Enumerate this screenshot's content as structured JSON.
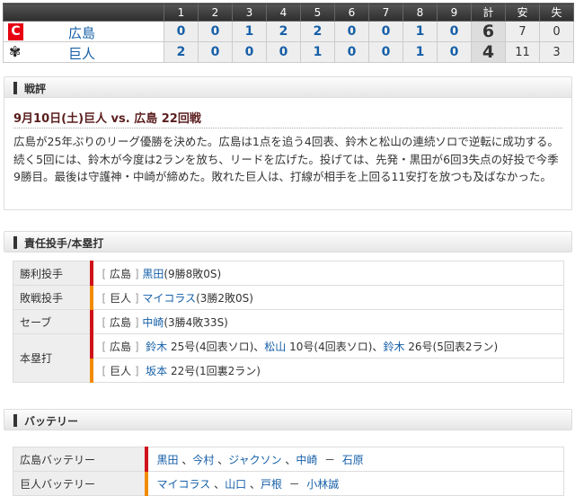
{
  "scoreboard": {
    "headers": [
      "1",
      "2",
      "3",
      "4",
      "5",
      "6",
      "7",
      "8",
      "9",
      "計",
      "安",
      "失"
    ],
    "teams": [
      {
        "name": "広島",
        "logo": "C",
        "innings": [
          "0",
          "0",
          "1",
          "2",
          "2",
          "0",
          "0",
          "1",
          "0"
        ],
        "total": "6",
        "hits": "7",
        "errors": "0"
      },
      {
        "name": "巨人",
        "logo": "G",
        "innings": [
          "2",
          "0",
          "0",
          "0",
          "1",
          "0",
          "0",
          "1",
          "0"
        ],
        "total": "4",
        "hits": "11",
        "errors": "3"
      }
    ]
  },
  "review": {
    "section_title": "戦評",
    "title": "9月10日(土)巨人 vs. 広島 22回戦",
    "text": "広島が25年ぶりのリーグ優勝を決めた。広島は1点を追う4回表、鈴木と松山の連続ソロで逆転に成功する。続く5回には、鈴木が今度は2ランを放ち、リードを広げた。投げては、先発・黒田が6回3失点の好投で今季9勝目。最後は守護神・中崎が締めた。敗れた巨人は、打線が相手を上回る11安打を放つも及ばなかった。"
  },
  "pitchers": {
    "section_title": "責任投手/本塁打",
    "win": {
      "label": "勝利投手",
      "team": "広島",
      "name": "黒田",
      "record": "(9勝8敗0S)"
    },
    "loss": {
      "label": "敗戦投手",
      "team": "巨人",
      "name": "マイコラス",
      "record": "(3勝2敗0S)"
    },
    "save": {
      "label": "セーブ",
      "team": "広島",
      "name": "中崎",
      "record": "(3勝4敗33S)"
    },
    "hr_label": "本塁打",
    "hr": [
      {
        "team": "広島",
        "entries": [
          {
            "name": "鈴木",
            "detail": "25号(4回表ソロ)"
          },
          {
            "name": "松山",
            "detail": "10号(4回表ソロ)"
          },
          {
            "name": "鈴木",
            "detail": "26号(5回表2ラン)"
          }
        ]
      },
      {
        "team": "巨人",
        "entries": [
          {
            "name": "坂本",
            "detail": "22号(1回裏2ラン)"
          }
        ]
      }
    ]
  },
  "battery": {
    "section_title": "バッテリー",
    "rows": [
      {
        "label": "広島バッテリー",
        "pitchers": [
          "黒田",
          "今村",
          "ジャクソン",
          "中崎"
        ],
        "catchers": [
          "石原"
        ]
      },
      {
        "label": "巨人バッテリー",
        "pitchers": [
          "マイコラス",
          "山口",
          "戸根"
        ],
        "catchers": [
          "小林誠"
        ]
      }
    ]
  },
  "colors": {
    "carp": "#d0121b",
    "giants": "#f08c00",
    "link": "#1760a8"
  }
}
